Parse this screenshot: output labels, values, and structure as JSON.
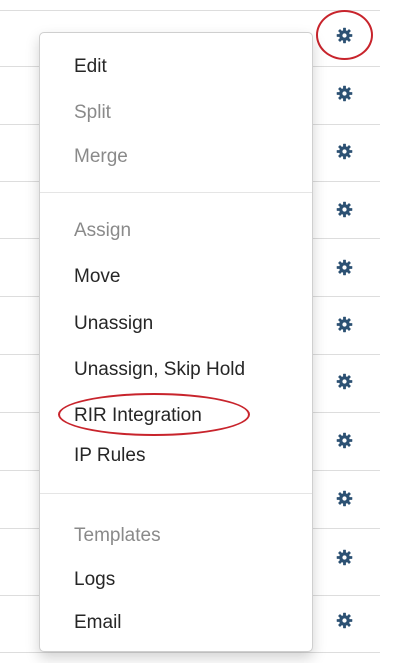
{
  "menu": {
    "items": [
      {
        "label": "Edit",
        "enabled": true
      },
      {
        "label": "Split",
        "enabled": false
      },
      {
        "label": "Merge",
        "enabled": false
      },
      {
        "label": "Assign",
        "enabled": false
      },
      {
        "label": "Move",
        "enabled": true
      },
      {
        "label": "Unassign",
        "enabled": true
      },
      {
        "label": "Unassign, Skip Hold",
        "enabled": true
      },
      {
        "label": "RIR Integration",
        "enabled": true
      },
      {
        "label": "IP Rules",
        "enabled": true
      },
      {
        "label": "Templates",
        "enabled": false
      },
      {
        "label": "Logs",
        "enabled": true
      },
      {
        "label": "Email",
        "enabled": true
      }
    ]
  },
  "row_actions": {
    "icon": "gear-icon",
    "count": 11
  },
  "colors": {
    "gear": "#2c5173",
    "annotation": "#c8242c",
    "text": "#262626",
    "disabled_text": "#8a8a8a",
    "divider": "#dddddd"
  },
  "annotations": [
    "gear-icon-top-row",
    "menu-item-rir-integration"
  ]
}
